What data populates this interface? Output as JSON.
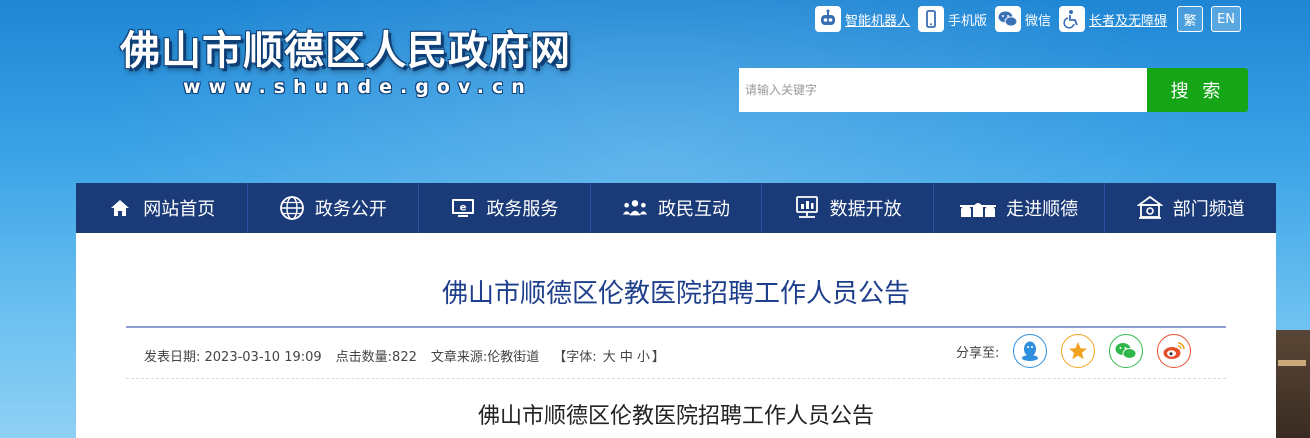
{
  "header": {
    "site_title": "佛山市顺德区人民政府网",
    "site_url": "www.shunde.gov.cn",
    "top_links": [
      {
        "label": "智能机器人",
        "icon": "robot-icon"
      },
      {
        "label": "手机版",
        "icon": "mobile-icon"
      },
      {
        "label": "微信",
        "icon": "wechat-icon"
      },
      {
        "label": "长者及无障碍",
        "icon": "accessibility-icon"
      }
    ],
    "lang_traditional": "繁",
    "lang_english": "EN",
    "search": {
      "placeholder": "请输入关键字",
      "button_label": "搜 索"
    }
  },
  "nav": {
    "items": [
      {
        "label": "网站首页",
        "icon": "home-icon"
      },
      {
        "label": "政务公开",
        "icon": "globe-icon"
      },
      {
        "label": "政务服务",
        "icon": "service-icon"
      },
      {
        "label": "政民互动",
        "icon": "people-icon"
      },
      {
        "label": "数据开放",
        "icon": "data-icon"
      },
      {
        "label": "走进顺德",
        "icon": "landmark-icon"
      },
      {
        "label": "部门频道",
        "icon": "department-icon"
      }
    ]
  },
  "article": {
    "title": "佛山市顺德区伦教医院招聘工作人员公告",
    "publish_date": "发表日期: 2023-03-10 19:09",
    "views": "点击数量:822",
    "source": "文章来源:伦教街道",
    "font_size_prefix": "【字体:",
    "font_large": "大",
    "font_medium": "中",
    "font_small": "小",
    "font_size_suffix": "】",
    "share_label": "分享至:",
    "share_targets": [
      "qq-icon",
      "qzone-icon",
      "wechat-share-icon",
      "weibo-icon"
    ],
    "body_title": "佛山市顺德区伦教医院招聘工作人员公告"
  },
  "colors": {
    "nav_bg": "#1b3a78",
    "search_button": "#16a516",
    "title_blue": "#1e3f8c"
  }
}
